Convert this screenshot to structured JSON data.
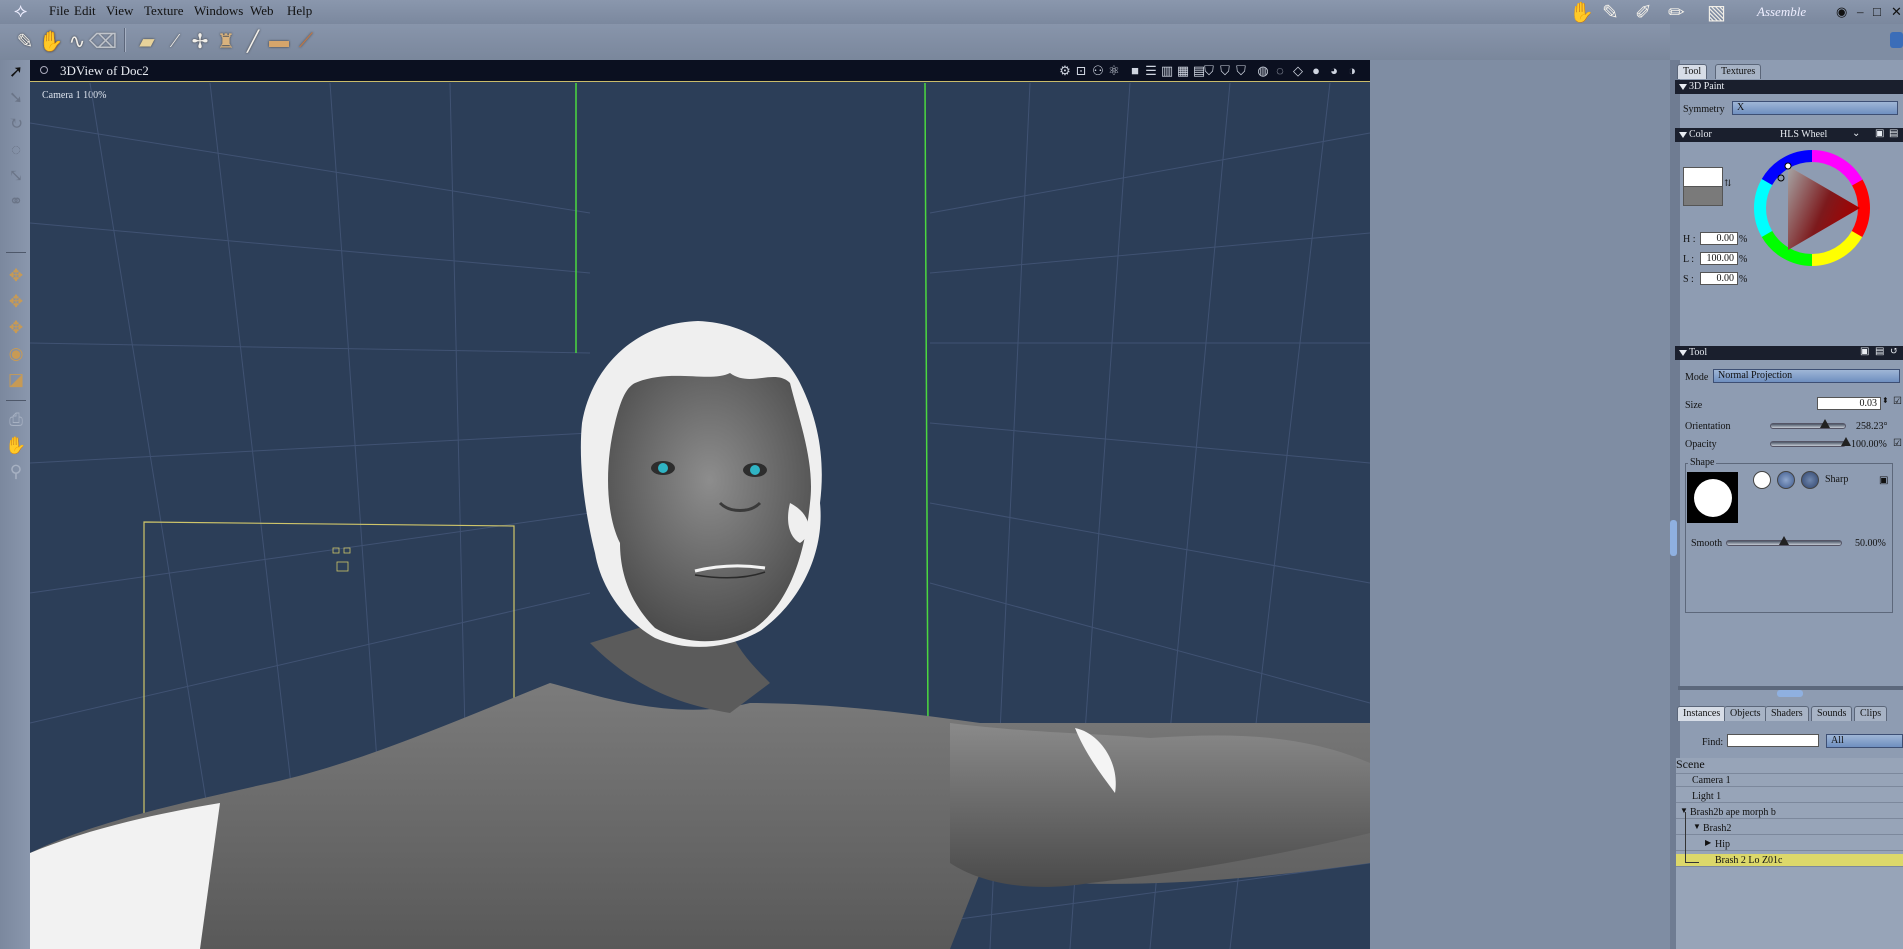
{
  "menubar": {
    "items": [
      "File",
      "Edit",
      "View",
      "Texture",
      "Windows",
      "Web",
      "Help"
    ],
    "room": "Assemble"
  },
  "toolbar": {
    "icons": [
      "3d-paint-tool-icon",
      "grab-hand-icon",
      "smooth-brush-icon",
      "eraser-icon",
      "paint-bucket-icon",
      "brush-icon",
      "airbrush-icon",
      "stamp-icon",
      "pencil-icon",
      "pattern-brush-icon",
      "eyedropper-icon"
    ]
  },
  "viewport": {
    "title": "3DView of Doc2",
    "camera_label": "Camera 1 100%"
  },
  "right_panel": {
    "top_tabs": [
      "Tool",
      "Textures"
    ],
    "paint_section": "3D Paint",
    "symmetry_label": "Symmetry",
    "symmetry_value": "X",
    "color_section": "Color",
    "color_mode": "HLS Wheel",
    "hls": {
      "h_label": "H :",
      "h_value": "0.00",
      "l_label": "L :",
      "l_value": "100.00",
      "s_label": "S :",
      "s_value": "0.00",
      "unit": "%"
    },
    "tool_section": "Tool",
    "mode_label": "Mode",
    "mode_value": "Normal Projection",
    "size_label": "Size",
    "size_value": "0.03",
    "orientation_label": "Orientation",
    "orientation_value": "258.23°",
    "orientation_level": 0.72,
    "opacity_label": "Opacity",
    "opacity_value": "100.00%",
    "opacity_level": 1.0,
    "shape_label": "Shape",
    "sharp_label": "Sharp",
    "smooth_label": "Smooth",
    "smooth_value": "50.00%",
    "smooth_level": 0.5
  },
  "scene_panel": {
    "tabs": [
      "Instances",
      "Objects",
      "Shaders",
      "Sounds",
      "Clips"
    ],
    "find_label": "Find:",
    "filter_value": "All",
    "root": "Scene",
    "items": [
      {
        "label": "Camera 1",
        "indent": 0
      },
      {
        "label": "Light 1",
        "indent": 0
      },
      {
        "label": "Brash2b ape morph b",
        "indent": 0
      },
      {
        "label": "Brash2",
        "indent": 1
      },
      {
        "label": "Hip",
        "indent": 2
      },
      {
        "label": "Brash 2 Lo Z01c",
        "indent": 2,
        "selected": true
      }
    ]
  },
  "colors": {
    "viewport_bg": "#2c3e58",
    "panel_bg": "#8e9cb2",
    "selected_row": "#dcd86a",
    "guide_green": "#4bd83f"
  }
}
